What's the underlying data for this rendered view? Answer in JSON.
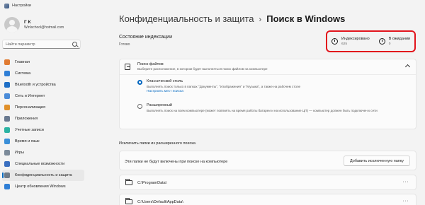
{
  "window": {
    "title": "Настройки"
  },
  "user": {
    "name": "Г К",
    "email": "Winlschool@hotmail.com"
  },
  "search": {
    "placeholder": "Найти параметр"
  },
  "sidebar": {
    "items": [
      {
        "label": "Главная",
        "icon": "home-icon",
        "color": "#e07b32"
      },
      {
        "label": "Система",
        "icon": "system-icon",
        "color": "#2f7fd6"
      },
      {
        "label": "Bluetooth и устройства",
        "icon": "bluetooth-icon",
        "color": "#1f6fc6"
      },
      {
        "label": "Сеть и Интернет",
        "icon": "network-icon",
        "color": "#4a8bd8"
      },
      {
        "label": "Персонализация",
        "icon": "personalization-icon",
        "color": "#e0902a"
      },
      {
        "label": "Приложения",
        "icon": "apps-icon",
        "color": "#6a7a90"
      },
      {
        "label": "Учетные записи",
        "icon": "accounts-icon",
        "color": "#2bb3a3"
      },
      {
        "label": "Время и язык",
        "icon": "time-language-icon",
        "color": "#3a8fd8"
      },
      {
        "label": "Игры",
        "icon": "gaming-icon",
        "color": "#7b8a99"
      },
      {
        "label": "Специальные возможности",
        "icon": "accessibility-icon",
        "color": "#3a6fc0"
      },
      {
        "label": "Конфиденциальность и защита",
        "icon": "privacy-icon",
        "color": "#6f7b88",
        "active": true
      },
      {
        "label": "Центр обновления Windows",
        "icon": "windows-update-icon",
        "color": "#2f7fd6"
      }
    ]
  },
  "breadcrumb": {
    "parent": "Конфиденциальность и защита",
    "separator": "›",
    "current": "Поиск в Windows"
  },
  "indexing": {
    "title": "Состояние индексации",
    "status": "Готово",
    "indexed_label": "Индексировано",
    "indexed_value": "625",
    "pending_label": "В ожидании",
    "pending_value": "0"
  },
  "find_files": {
    "title": "Поиск файлов",
    "description": "Выберите расположение, в котором будет выполняться поиск файлов на компьютере",
    "classic_title": "Классический стиль",
    "classic_desc": "Выполнять поиск только в папках \"Документы\", \"Изображения\" и \"Музыка\", а также на рабочем столе",
    "classic_link": "Настроить мест поиска",
    "enhanced_title": "Расширенный",
    "enhanced_desc": "Выполнять поиск на всем компьютере (может повлиять на время работы батареи и на использование ЦП) — компьютер должен быть подключен к сети"
  },
  "exclude": {
    "section_title": "Исключить папки из расширенного поиска",
    "text": "Эти папки не будут включены при поиске на компьютере",
    "button": "Добавить исключенную папку",
    "folders": [
      {
        "path": "C:\\ProgramData\\"
      },
      {
        "path": "C:\\Users\\Default\\AppData\\"
      }
    ]
  },
  "accent_color": "#0067c0",
  "highlight_color": "#e2141c"
}
